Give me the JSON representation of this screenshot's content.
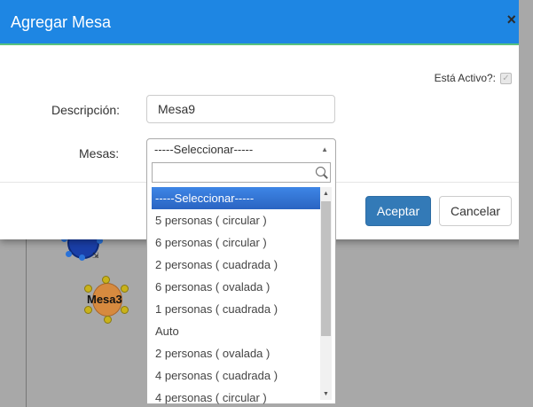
{
  "modal": {
    "title": "Agregar Mesa",
    "close_symbol": "×",
    "active_label": "Está Activo?:",
    "description_label": "Descripción:",
    "description_value": "Mesa9",
    "tables_label": "Mesas:",
    "select_value": "-----Seleccionar-----",
    "accept_label": "Aceptar",
    "cancel_label": "Cancelar"
  },
  "dropdown": {
    "options": [
      "-----Seleccionar-----",
      "5 personas ( circular )",
      "6 personas ( circular )",
      "2 personas ( cuadrada )",
      "6 personas ( ovalada )",
      "1 personas ( cuadrada )",
      "Auto",
      "2 personas ( ovalada )",
      "4 personas ( cuadrada )",
      "4 personas ( circular )"
    ]
  },
  "background": {
    "table_label": "Mesa3"
  },
  "colors": {
    "header": "#1e86e3",
    "primary_button": "#337ab7",
    "selected_option": "#3575d3"
  }
}
